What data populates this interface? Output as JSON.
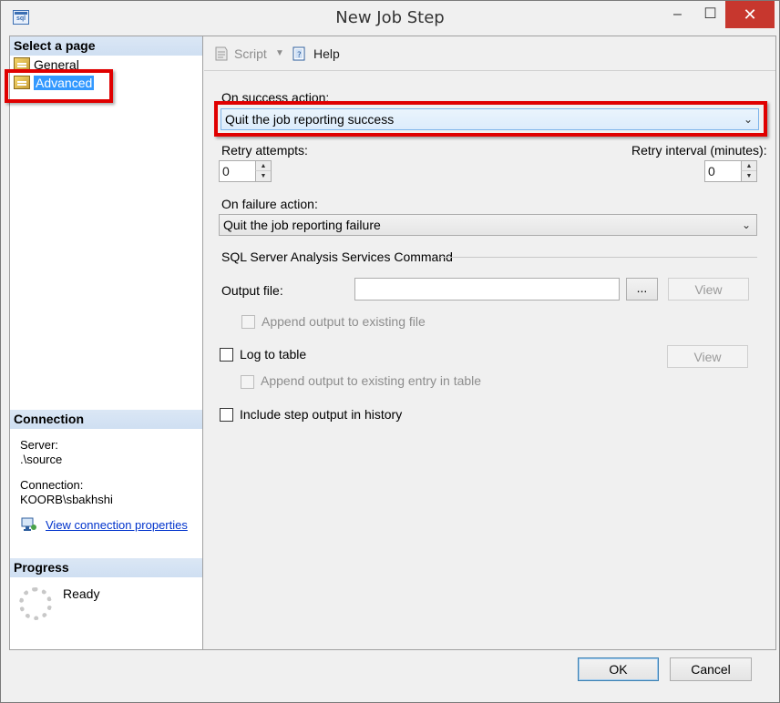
{
  "window": {
    "title": "New Job Step",
    "minimize": "‒",
    "maximize": "☐",
    "close": "✕"
  },
  "left": {
    "select_page_header": "Select a page",
    "pages": [
      {
        "label": "General"
      },
      {
        "label": "Advanced"
      }
    ],
    "connection_header": "Connection",
    "server_label": "Server:",
    "server_value": ".\\source",
    "connection_label": "Connection:",
    "connection_value": "KOORB\\sbakhshi",
    "view_connection_link": "View connection properties",
    "progress_header": "Progress",
    "progress_status": "Ready"
  },
  "toolbar": {
    "script_label": "Script",
    "help_label": "Help"
  },
  "form": {
    "on_success_label": "On success action:",
    "on_success_value": "Quit the job reporting success",
    "retry_attempts_label": "Retry attempts:",
    "retry_attempts_value": "0",
    "retry_interval_label": "Retry interval (minutes):",
    "retry_interval_value": "0",
    "on_failure_label": "On failure action:",
    "on_failure_value": "Quit the job reporting failure",
    "ssas_section": "SQL Server Analysis Services Command",
    "output_file_label": "Output file:",
    "output_file_value": "",
    "browse_label": "...",
    "view_label": "View",
    "append_output_label": "Append output to existing file",
    "log_to_table_label": "Log to table",
    "view_table_label": "View",
    "append_entry_label": "Append output to existing entry in table",
    "include_history_label": "Include step output in history"
  },
  "footer": {
    "ok_label": "OK",
    "cancel_label": "Cancel"
  },
  "colors": {
    "highlight_red": "#e00000",
    "selection_blue": "#3399ff",
    "close_red": "#c7372e"
  }
}
